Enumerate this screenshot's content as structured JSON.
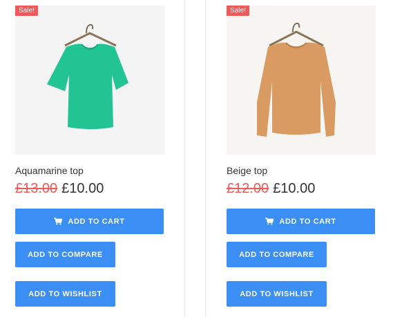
{
  "products": [
    {
      "badge": "Sale!",
      "name": "Aquamarine top",
      "old_price": "£13.00",
      "new_price": "£10.00",
      "image_color": "#23c494",
      "image_name": "aquamarine-top-image",
      "add_to_cart": "ADD TO CART",
      "add_to_compare": "ADD TO COMPARE",
      "add_to_wishlist": "ADD TO WISHLIST"
    },
    {
      "badge": "Sale!",
      "name": "Beige top",
      "old_price": "£12.00",
      "new_price": "£10.00",
      "image_color": "#d99b62",
      "image_name": "beige-top-image",
      "add_to_cart": "ADD TO CART",
      "add_to_compare": "ADD TO COMPARE",
      "add_to_wishlist": "ADD TO WISHLIST"
    }
  ],
  "colors": {
    "accent": "#3b8ef3",
    "sale": "#ef5a5a",
    "text": "#333333"
  },
  "icons": {
    "cart": "shopping-cart-icon"
  }
}
